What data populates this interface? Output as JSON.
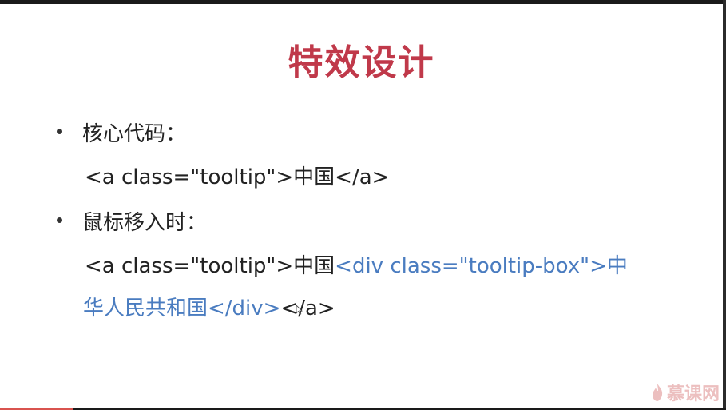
{
  "slide": {
    "title": "特效设计",
    "bullets": [
      {
        "label": "核心代码：",
        "code_lines": [
          [
            {
              "text": "<a class=\"tooltip\">中国</a>",
              "color": "black"
            }
          ]
        ]
      },
      {
        "label": "鼠标移入时：",
        "code_lines": [
          [
            {
              "text": "<a class=\"tooltip\">中国",
              "color": "black"
            },
            {
              "text": "<div class=\"tooltip-box\">中",
              "color": "blue"
            }
          ],
          [
            {
              "text": "华人民共和国</div>",
              "color": "blue"
            },
            {
              "text": "</a>",
              "color": "black"
            }
          ]
        ]
      }
    ]
  },
  "logo": {
    "text": "慕课网",
    "icon": "flame-icon"
  },
  "video_progress": 0.1,
  "colors": {
    "title": "#c0394a",
    "code_blue": "#4a7cc0",
    "text": "#222222"
  }
}
